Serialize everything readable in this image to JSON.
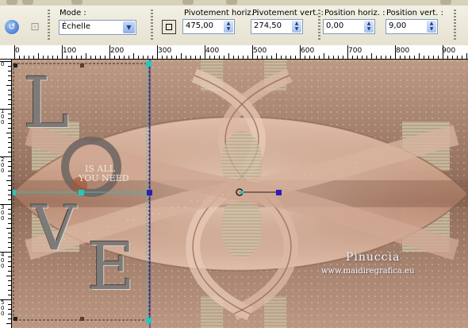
{
  "toolbar": {
    "mode_label": "Mode :",
    "mode_value": "Échelle",
    "pivot_h_label": "Pivotement horiz. :",
    "pivot_h_value": "475,00",
    "pivot_v_label": "Pivotement vert. :",
    "pivot_v_value": "274,50",
    "pos_h_label": "Position horiz. :",
    "pos_h_value": "0,00",
    "pos_v_label": "Position vert. :",
    "pos_v_value": "9,00"
  },
  "ruler": {
    "h_labels": [
      "0",
      "100",
      "200",
      "300",
      "400",
      "500",
      "600",
      "700",
      "800",
      "900"
    ],
    "v_labels": [
      "0",
      "1\n0\n0",
      "2\n0\n0",
      "3\n0\n0",
      "4\n0\n0",
      "5\n0\n0"
    ]
  },
  "canvas": {
    "love_text": [
      "L",
      "O",
      "V",
      "E"
    ],
    "love_subtitle_1": "IS ALL",
    "love_subtitle_2": "YOU NEED",
    "watermark_name": "Pinuccia",
    "watermark_url": "www.maidiregrafica.eu"
  },
  "colors": {
    "canvas_bg": "#c9a690",
    "guide_cyan": "#1fc9c0",
    "guide_blue": "#2b1fb5",
    "toolbar_bg": "#ece9d8"
  },
  "icons": [
    "undo-icon",
    "deform-icon",
    "pivot-box-icon",
    "spin-arrow-icon",
    "dropdown-arrow-icon"
  ]
}
